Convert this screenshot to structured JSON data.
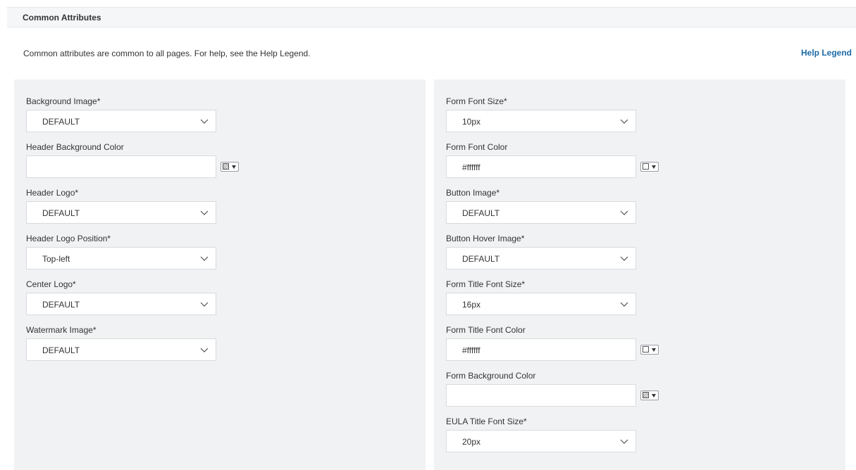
{
  "section": {
    "title": "Common Attributes",
    "description": "Common attributes are common to all pages. For help, see the Help Legend.",
    "help_link": "Help Legend"
  },
  "left_fields": [
    {
      "label": "Background Image*",
      "type": "select",
      "value": "DEFAULT"
    },
    {
      "label": "Header Background Color",
      "type": "color",
      "value": "",
      "swatch": "empty"
    },
    {
      "label": "Header Logo*",
      "type": "select",
      "value": "DEFAULT"
    },
    {
      "label": "Header Logo Position*",
      "type": "select",
      "value": "Top-left"
    },
    {
      "label": "Center Logo*",
      "type": "select",
      "value": "DEFAULT"
    },
    {
      "label": "Watermark Image*",
      "type": "select",
      "value": "DEFAULT"
    }
  ],
  "right_fields": [
    {
      "label": "Form Font Size*",
      "type": "select",
      "value": "10px"
    },
    {
      "label": "Form Font Color",
      "type": "color",
      "value": "#ffffff",
      "swatch": "#ffffff"
    },
    {
      "label": "Button Image*",
      "type": "select",
      "value": "DEFAULT"
    },
    {
      "label": "Button Hover Image*",
      "type": "select",
      "value": "DEFAULT"
    },
    {
      "label": "Form Title Font Size*",
      "type": "select",
      "value": "16px"
    },
    {
      "label": "Form Title Font Color",
      "type": "color",
      "value": "#ffffff",
      "swatch": "#ffffff"
    },
    {
      "label": "Form Background Color",
      "type": "color",
      "value": "",
      "swatch": "empty"
    },
    {
      "label": "EULA Title Font Size*",
      "type": "select",
      "value": "20px"
    }
  ],
  "icons": {
    "chevron": "chevron-down-icon",
    "color_picker": "color-picker-icon"
  },
  "colors": {
    "link": "#1d6aa5",
    "panel_bg": "#f1f2f4",
    "header_bg": "#f5f6f7"
  }
}
